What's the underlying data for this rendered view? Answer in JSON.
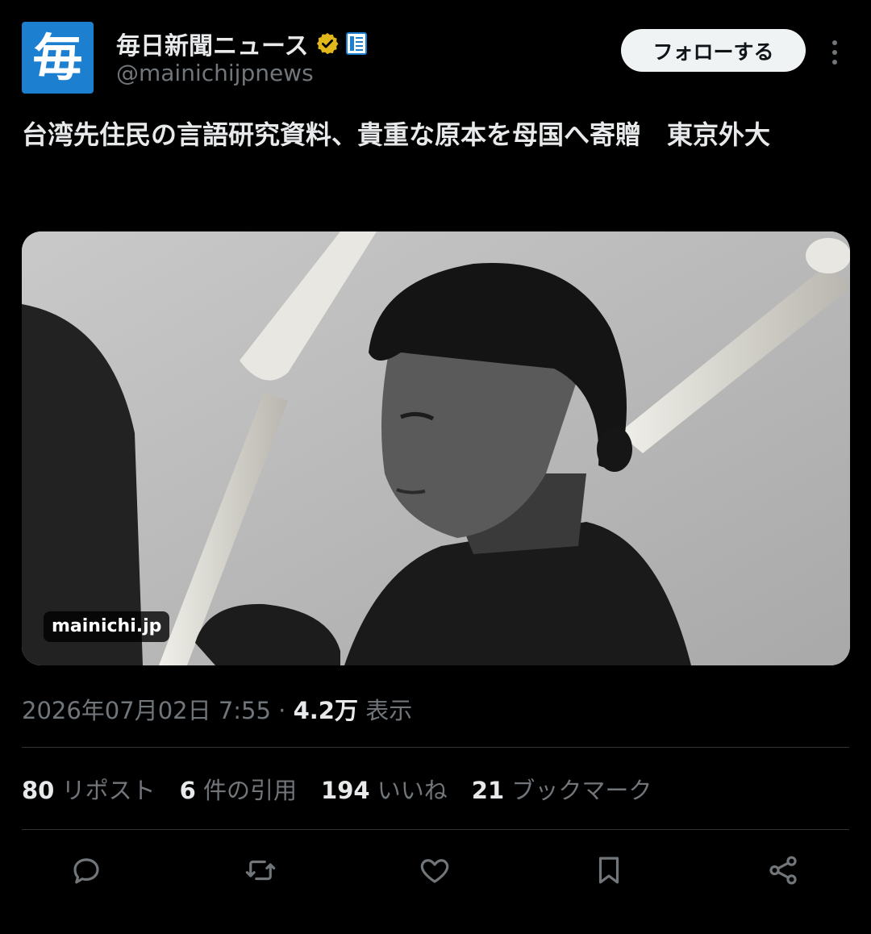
{
  "author": {
    "avatar_glyph": "毎",
    "name": "毎日新聞ニュース",
    "handle": "@mainichijpnews",
    "verified_icon": "gold-check-badge",
    "affiliate_icon": "newspaper-badge"
  },
  "follow_label": "フォローする",
  "tweet": {
    "text": "台湾先住民の言語研究資料、貴重な原本を母国へ寄贈　東京外大"
  },
  "media": {
    "source_label": "mainichi.jp"
  },
  "meta": {
    "timestamp": "2026年07月02日 7:55",
    "separator": "·",
    "views_count": "4.2万",
    "views_label": "表示"
  },
  "stats": {
    "reposts": {
      "count": "80",
      "label": "リポスト"
    },
    "quotes": {
      "count": "6",
      "label": "件の引用"
    },
    "likes": {
      "count": "194",
      "label": "いいね"
    },
    "bookmarks": {
      "count": "21",
      "label": "ブックマーク"
    }
  },
  "actions": [
    "reply-icon",
    "repost-icon",
    "like-icon",
    "bookmark-icon",
    "share-icon"
  ],
  "colors": {
    "background": "#000000",
    "text_primary": "#e7e9ea",
    "text_secondary": "#71767b",
    "avatar_blue": "#1d7fd0",
    "verified_gold": "#e2b719",
    "follow_bg": "#eff3f4"
  }
}
